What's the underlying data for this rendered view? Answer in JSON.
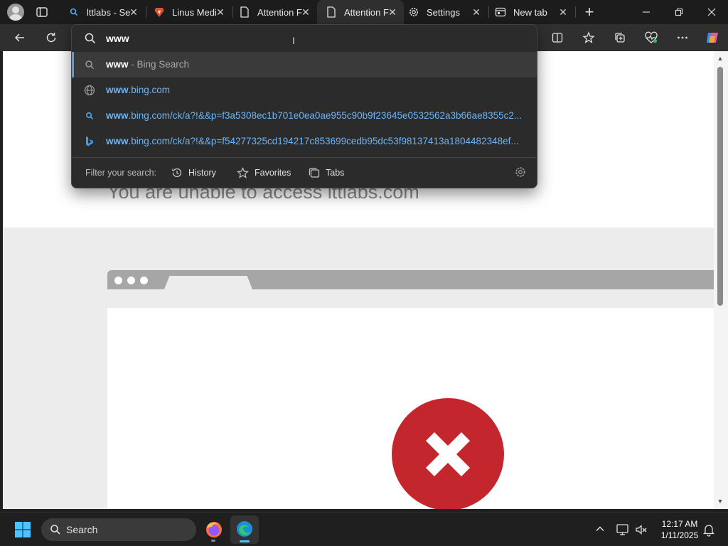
{
  "browser": {
    "tabs": [
      {
        "title": "lttlabs - Se",
        "favicon": "bing-search-icon",
        "active": false
      },
      {
        "title": "Linus Medi",
        "favicon": "brave-icon",
        "active": false
      },
      {
        "title": "Attention F",
        "favicon": "page-icon",
        "active": false
      },
      {
        "title": "Attention F",
        "favicon": "page-icon",
        "active": true
      },
      {
        "title": "Settings",
        "favicon": "gear-icon",
        "active": false
      },
      {
        "title": "New tab",
        "favicon": "newtab-icon",
        "active": false
      }
    ],
    "tab_close_glyph": "✕",
    "new_tab_glyph": "+"
  },
  "omnibox": {
    "input_value": "www",
    "suggestions": [
      {
        "bold": "www",
        "rest": " - Bing Search",
        "icon": "search-icon",
        "type": "search"
      },
      {
        "bold": "www",
        "rest": ".bing.com",
        "icon": "globe-icon",
        "type": "url"
      },
      {
        "bold": "www",
        "rest": ".bing.com/ck/a?!&&p=f3a5308ec1b701e0ea0ae955c90b9f23645e0532562a3b66ae8355c2...",
        "icon": "search-icon",
        "type": "url"
      },
      {
        "bold": "www",
        "rest": ".bing.com/ck/a?!&&p=f54277325cd194217c853699cedb95dc53f98137413a1804482348ef...",
        "icon": "bing-icon",
        "type": "url"
      }
    ],
    "filter_label": "Filter your search:",
    "filters": [
      {
        "label": "History",
        "icon": "history-icon"
      },
      {
        "label": "Favorites",
        "icon": "star-icon"
      },
      {
        "label": "Tabs",
        "icon": "tabs-icon"
      }
    ]
  },
  "page": {
    "error_heading": "You are unable to access lttlabs.com"
  },
  "taskbar": {
    "search_placeholder": "Search",
    "time": "12:17 AM",
    "date": "1/11/2025"
  },
  "colors": {
    "accent_blue": "#5b9bd5",
    "url_blue": "#6cb4f5",
    "error_red": "#c4262e"
  }
}
